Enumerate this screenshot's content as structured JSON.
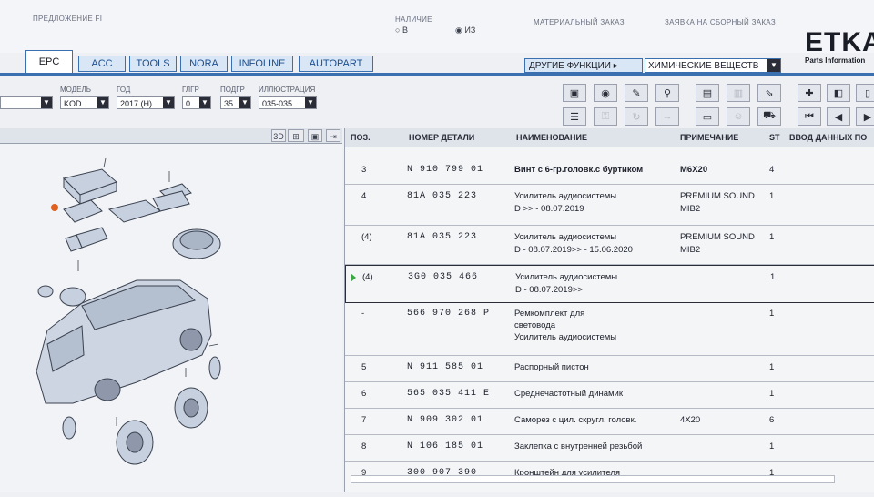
{
  "header": {
    "proposal_label": "ПРЕДЛОЖЕНИЕ FI",
    "availability_label": "НАЛИЧИЕ",
    "avail_option_a": "В",
    "avail_option_b": "ИЗ",
    "material_order": "МАТЕРИАЛЬНЫЙ ЗАКАЗ",
    "assembly_order": "ЗАЯВКА НА СБОРНЫЙ ЗАКАЗ",
    "logo": "ETKA",
    "logo_sub": "Parts Information"
  },
  "tabs": [
    "EPC",
    "ACC",
    "TOOLS",
    "NORA",
    "INFOLINE",
    "AUTOPART"
  ],
  "other_functions": {
    "button": "ДРУГИЕ ФУНКЦИИ ▸",
    "select_value": "ХИМИЧЕСКИЕ ВЕЩЕСТВ"
  },
  "filters": {
    "model_label": "МОДЕЛЬ",
    "model_value": "KOD",
    "year_label": "ГОД",
    "year_value": "2017 (H)",
    "group_label": "ГЛГР",
    "group_value": "0",
    "subgroup_label": "ПОДГР",
    "subgroup_value": "35",
    "illus_label": "ИЛЛЮСТРАЦИЯ",
    "illus_value": "035-035"
  },
  "image_tools": {
    "view3d": "3D"
  },
  "table": {
    "headers": [
      "ПОЗ.",
      "НОМЕР ДЕТАЛИ",
      "НАИМЕНОВАНИЕ",
      "ПРИМЕЧАНИЕ",
      "ST",
      "ВВОД ДАННЫХ ПО"
    ],
    "rows": [
      {
        "pos": "3",
        "num": "N    910 799 01",
        "name1": "Винт с 6-гр.головк.с буртиком",
        "name2": "",
        "name3": "",
        "note1": "M6X20",
        "note2": "",
        "qty": "4"
      },
      {
        "pos": "4",
        "num": "81A 035 223",
        "name1": "Усилитель аудиосистемы",
        "name2": "D              >> - 08.07.2019",
        "name3": "",
        "note1": "PREMIUM SOUND",
        "note2": "MIB2",
        "qty": "1"
      },
      {
        "pos": "(4)",
        "num": "81A 035 223",
        "name1": "Усилитель аудиосистемы",
        "name2": "D - 08.07.2019>> - 15.06.2020",
        "name3": "",
        "note1": "PREMIUM SOUND",
        "note2": "MIB2",
        "qty": "1"
      },
      {
        "pos": "(4)",
        "num": "3G0 035 466",
        "name1": "Усилитель аудиосистемы",
        "name2": "D - 08.07.2019>>",
        "name3": "",
        "note1": "",
        "note2": "",
        "qty": "1"
      },
      {
        "pos": "-",
        "num": "566 970 268 P",
        "name1": "Ремкомплект для",
        "name2": "световода",
        "name3": "Усилитель аудиосистемы",
        "note1": "",
        "note2": "",
        "qty": "1"
      },
      {
        "pos": "5",
        "num": "N    911 585 01",
        "name1": "Распорный пистон",
        "name2": "",
        "name3": "",
        "note1": "",
        "note2": "",
        "qty": "1"
      },
      {
        "pos": "6",
        "num": "565 035 411 E",
        "name1": "Среднечастотный динамик",
        "name2": "",
        "name3": "",
        "note1": "",
        "note2": "",
        "qty": "1"
      },
      {
        "pos": "7",
        "num": "N    909 302 01",
        "name1": "Саморез с цил. скругл. головк.",
        "name2": "",
        "name3": "",
        "note1": "4X20",
        "note2": "",
        "qty": "6"
      },
      {
        "pos": "8",
        "num": "N    106 185 01",
        "name1": "Заклепка с внутренней резьбой",
        "name2": "",
        "name3": "",
        "note1": "",
        "note2": "",
        "qty": "1"
      },
      {
        "pos": "9",
        "num": "300 907 390",
        "name1": "Кронштейн для усилителя",
        "name2": "",
        "name3": "",
        "note1": "",
        "note2": "",
        "qty": "1"
      }
    ]
  }
}
